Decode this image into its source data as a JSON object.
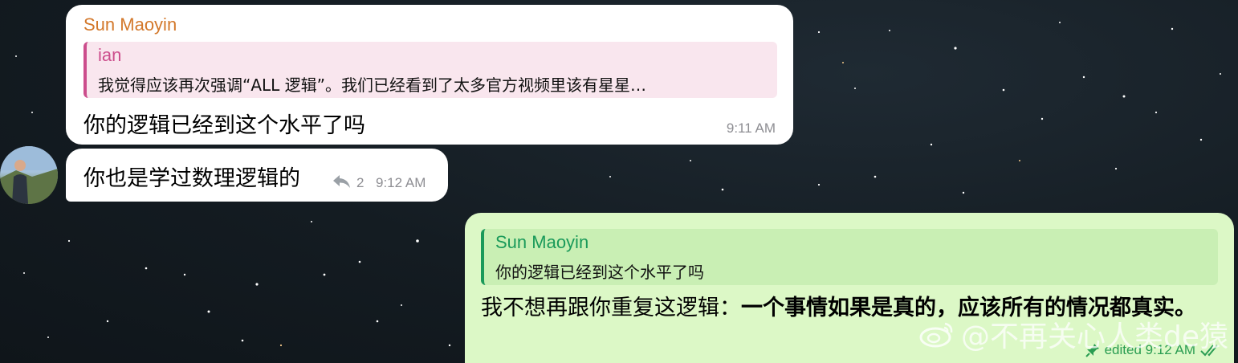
{
  "messages": {
    "m1": {
      "sender": "Sun Maoyin",
      "reply_to": {
        "name": "ian",
        "text": "我觉得应该再次强调“ALL 逻辑”。我们已经看到了太多官方视频里该有星星…"
      },
      "text": "你的逻辑已经到这个水平了吗",
      "time": "9:11 AM"
    },
    "m2": {
      "text": "你也是学过数理逻辑的",
      "reply_count": "2",
      "time": "9:12 AM"
    },
    "m3": {
      "reply_to": {
        "name": "Sun Maoyin",
        "text": "你的逻辑已经到这个水平了吗"
      },
      "text_plain": "我不想再跟你重复这逻辑：",
      "text_bold": "一个事情如果是真的，应该所有的情况都真实。",
      "status": "edited 9:12 AM"
    }
  },
  "watermark": "@不再关心人类de猿",
  "colors": {
    "sender_orange": "#d3782b",
    "quote_pink": "#cc4d8c",
    "own_bubble": "#dcf8c6",
    "own_accent": "#1a9a5a"
  }
}
